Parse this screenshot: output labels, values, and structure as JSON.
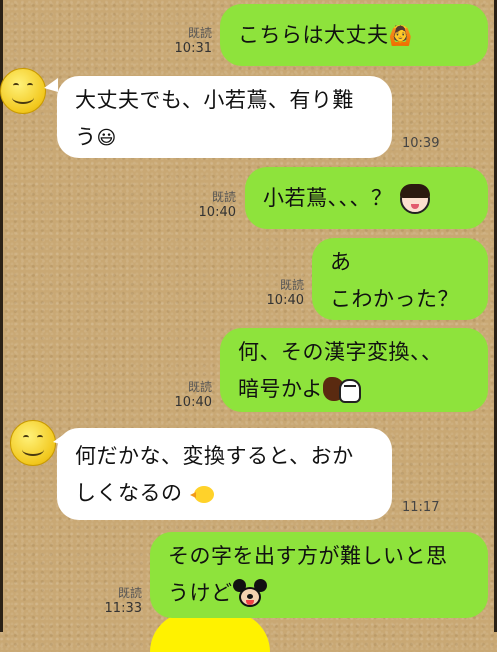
{
  "messages": [
    {
      "side": "out",
      "text": "こちらは大丈夫",
      "emoji": "🙆",
      "read": "既読",
      "time": "10:31"
    },
    {
      "side": "in",
      "line1": "大丈夫でも、小若蔦、有り難",
      "line2": "う",
      "emoji": "😃",
      "time": "10:39"
    },
    {
      "side": "out",
      "text": "小若蔦、、、？",
      "sticker": "girl-face-icon",
      "read": "既読",
      "time": "10:40"
    },
    {
      "side": "out",
      "line1": "あ",
      "line2": "こわかった？",
      "read": "既読",
      "time": "10:40"
    },
    {
      "side": "out",
      "line1": "何、その漢字変換、、",
      "line2": "暗号かよ",
      "sticker": "splat-ghost-icon",
      "read": "既読",
      "time": "10:40"
    },
    {
      "side": "in",
      "line1": "何だかな、変換すると、おか",
      "line2": "しくなるの",
      "sticker": "chick-icon",
      "time": "11:17"
    },
    {
      "side": "out",
      "line1": "その字を出す方が難しいと思",
      "line2": "うけど",
      "sticker": "mouse-face-icon",
      "read": "既読",
      "time": "11:33"
    }
  ],
  "colors": {
    "outgoing": "#8ee33c",
    "incoming": "#ffffff",
    "background": "#c9a874"
  }
}
